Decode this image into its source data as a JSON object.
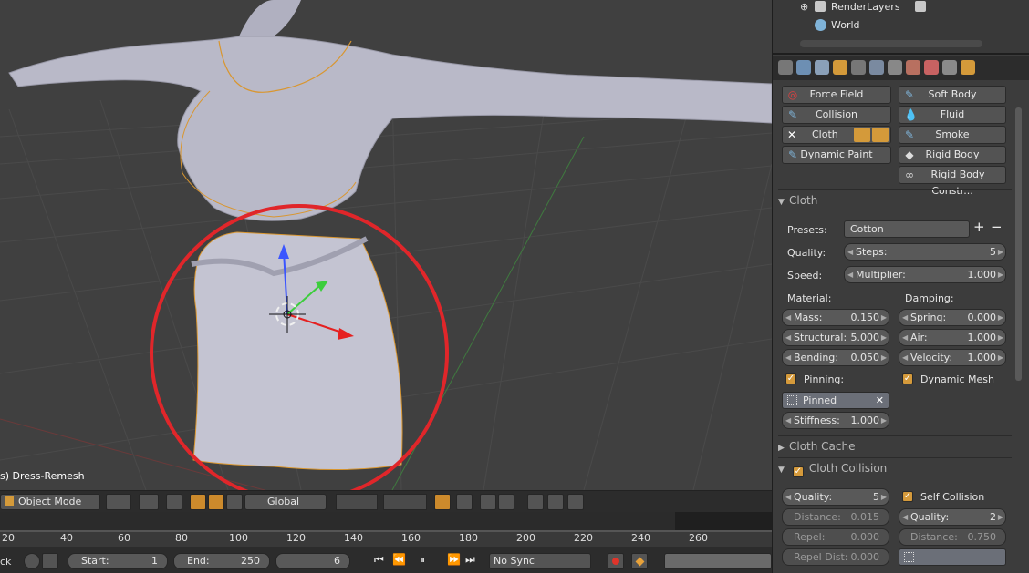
{
  "viewport": {
    "object_label": "s) Dress-Remesh"
  },
  "header": {
    "mode": "Object Mode",
    "orientation": "Global"
  },
  "timeline": {
    "ticks": [
      "20",
      "40",
      "60",
      "80",
      "100",
      "120",
      "140",
      "160",
      "180",
      "200",
      "220",
      "240",
      "260"
    ]
  },
  "bottom": {
    "left_cut": "ck",
    "start_label": "Start:",
    "start_value": "1",
    "end_label": "End:",
    "end_value": "250",
    "current_frame": "6",
    "sync": "No Sync"
  },
  "outliner": {
    "render_layers": "RenderLayers",
    "world": "World"
  },
  "physics": {
    "force_field": "Force Field",
    "soft_body": "Soft Body",
    "collision": "Collision",
    "fluid": "Fluid",
    "cloth": "Cloth",
    "smoke": "Smoke",
    "dynamic_paint": "Dynamic Paint",
    "rigid_body": "Rigid Body",
    "rigid_body_constraint": "Rigid Body Constr..."
  },
  "cloth_panel": {
    "title": "Cloth",
    "presets_label": "Presets:",
    "presets_value": "Cotton",
    "quality_label": "Quality:",
    "steps_label": "Steps:",
    "steps_value": "5",
    "speed_label": "Speed:",
    "multiplier_label": "Multiplier:",
    "multiplier_value": "1.000",
    "material_label": "Material:",
    "damping_label": "Damping:",
    "mass_label": "Mass:",
    "mass_value": "0.150",
    "spring_label": "Spring:",
    "spring_value": "0.000",
    "structural_label": "Structural:",
    "structural_value": "5.000",
    "air_label": "Air:",
    "air_value": "1.000",
    "bending_label": "Bending:",
    "bending_value": "0.050",
    "velocity_label": "Velocity:",
    "velocity_value": "1.000",
    "pinning_label": "Pinning:",
    "dynamic_mesh_label": "Dynamic Mesh",
    "pin_group": "Pinned",
    "stiffness_label": "Stiffness:",
    "stiffness_value": "1.000"
  },
  "cloth_cache": {
    "title": "Cloth Cache"
  },
  "cloth_collision": {
    "title": "Cloth Collision",
    "quality_label": "Quality:",
    "quality_value": "5",
    "self_collision_label": "Self Collision",
    "distance_label": "Distance:",
    "distance_value": "0.015",
    "self_quality_label": "Quality:",
    "self_quality_value": "2",
    "repel_label": "Repel:",
    "repel_value": "0.000",
    "self_distance_label": "Distance:",
    "self_distance_value": "0.750",
    "repel_dist_label": "Repel Dist:",
    "repel_dist_value": "0.000"
  }
}
